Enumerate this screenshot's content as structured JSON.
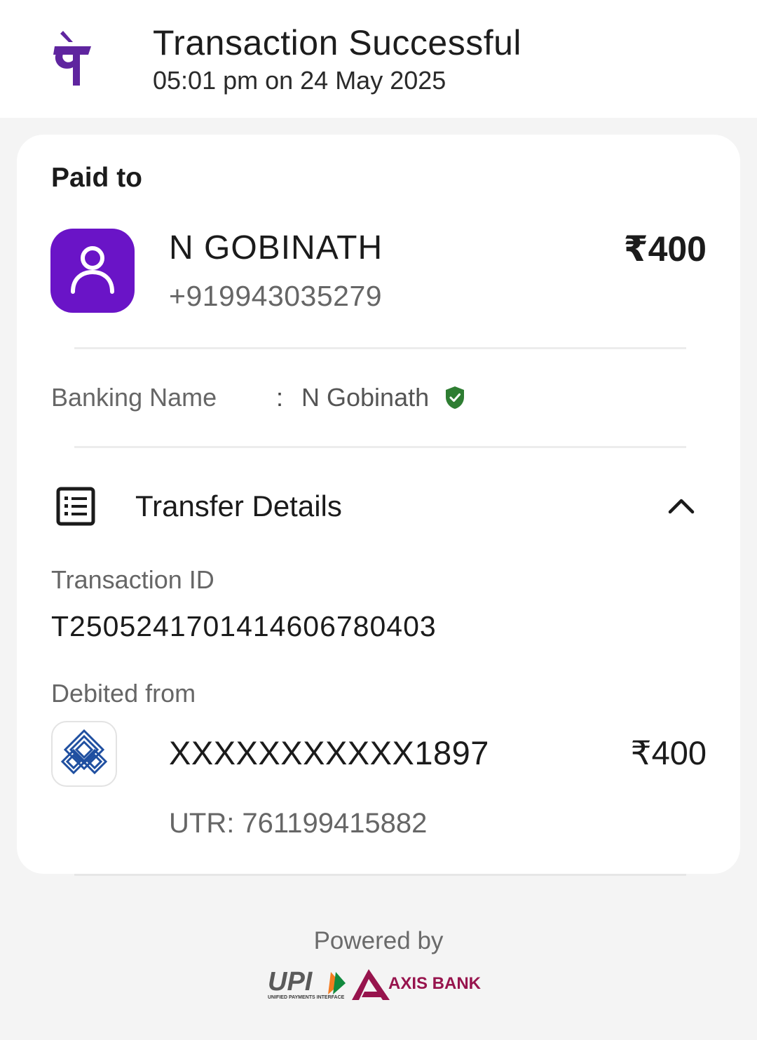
{
  "header": {
    "title": "Transaction Successful",
    "subtitle": "05:01 pm on 24 May 2025",
    "logo_icon": "phonepe-logo-icon",
    "brand_color": "#5f259f"
  },
  "payment": {
    "section_label": "Paid to",
    "payee_name": "N GOBINATH",
    "payee_phone": "+919943035279",
    "amount": "₹400",
    "avatar_icon": "user-icon",
    "avatar_color": "#6a14c7"
  },
  "banking": {
    "label": "Banking Name",
    "separator": ":",
    "value": "N Gobinath",
    "verified_icon": "verified-shield-icon",
    "verified_color": "#2e7d32"
  },
  "transfer": {
    "title": "Transfer Details",
    "icon": "receipt-list-icon",
    "toggle_icon": "chevron-up-icon",
    "transaction_id_label": "Transaction ID",
    "transaction_id": "T2505241701414606780403",
    "debited_from_label": "Debited from",
    "bank_icon": "bank-logo-icon",
    "account_number": "XXXXXXXXXXX1897",
    "debit_amount": "₹400",
    "utr": "UTR: 761199415882"
  },
  "footer": {
    "powered_by": "Powered by",
    "upi_logo_text": "UPI",
    "upi_tagline": "UNIFIED PAYMENTS INTERFACE",
    "axis_logo_text": "AXIS BANK",
    "axis_color": "#97144d"
  }
}
